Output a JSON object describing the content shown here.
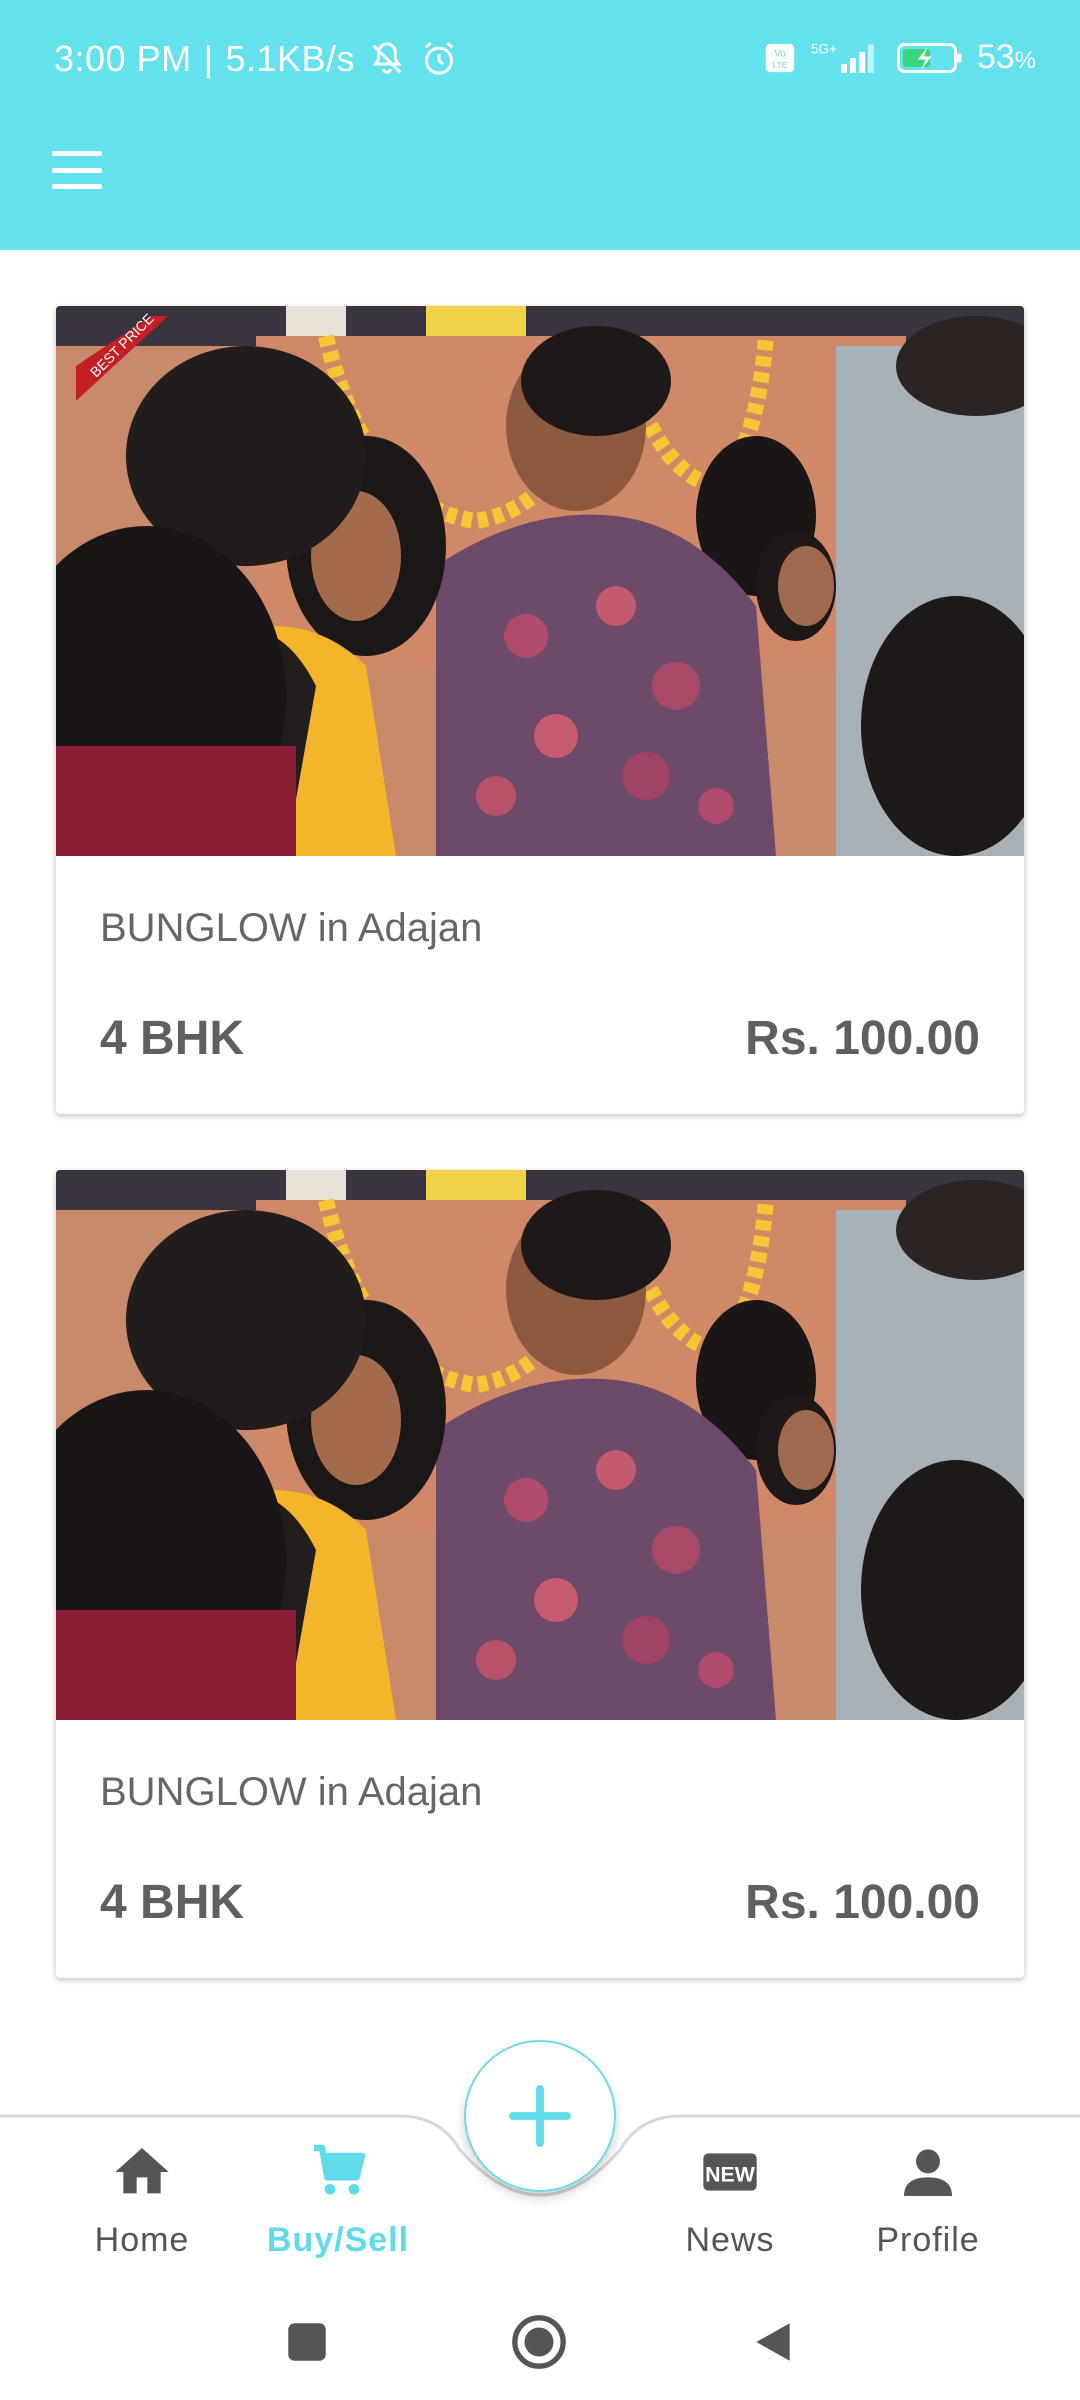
{
  "status_bar": {
    "time": "3:00 PM",
    "speed": "5.1KB/s",
    "network": "5G+",
    "volte": "Vo LTE",
    "battery": "53",
    "battery_unit": "%"
  },
  "app_bar": {
    "menu_icon": "hamburger-menu-icon"
  },
  "listings": [
    {
      "title": "BUNGLOW in Adajan",
      "bhk": "4 BHK",
      "price": "Rs. 100.00",
      "ribbon": "BEST PRICE"
    },
    {
      "title": "BUNGLOW in Adajan",
      "bhk": "4 BHK",
      "price": "Rs. 100.00"
    }
  ],
  "bottom_nav": {
    "home": "Home",
    "buy_sell": "Buy/Sell",
    "news": "News",
    "news_badge": "NEW",
    "profile": "Profile",
    "active": "buy_sell"
  },
  "colors": {
    "primary": "#63e2ee",
    "active_nav": "#5fdbea",
    "text": "#5f5f5f"
  }
}
